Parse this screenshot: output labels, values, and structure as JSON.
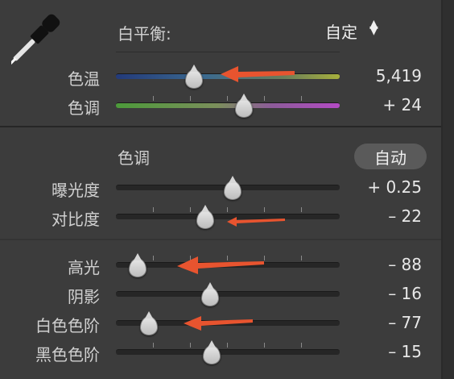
{
  "white_balance": {
    "label": "白平衡:",
    "value": "自定"
  },
  "sliders_wb": [
    {
      "label": "色温",
      "value": "5,419",
      "position": 0.35
    },
    {
      "label": "色调",
      "value": "+ 24",
      "position": 0.57
    }
  ],
  "tone": {
    "heading": "色调",
    "auto_label": "自动"
  },
  "sliders_tone": [
    {
      "label": "曝光度",
      "value": "+ 0.25",
      "position": 0.52
    },
    {
      "label": "对比度",
      "value": "– 22",
      "position": 0.4
    }
  ],
  "sliders_presence": [
    {
      "label": "高光",
      "value": "– 88",
      "position": 0.09
    },
    {
      "label": "阴影",
      "value": "– 16",
      "position": 0.42
    },
    {
      "label": "白色色阶",
      "value": "– 77",
      "position": 0.12
    },
    {
      "label": "黑色色阶",
      "value": "– 15",
      "position": 0.43
    }
  ],
  "colors": {
    "annotation_arrow": "#e8542f",
    "panel_bg": "#3c3c3c"
  },
  "icons": {
    "eyedropper": "eyedropper-icon",
    "updown": "updown-arrows-icon"
  }
}
